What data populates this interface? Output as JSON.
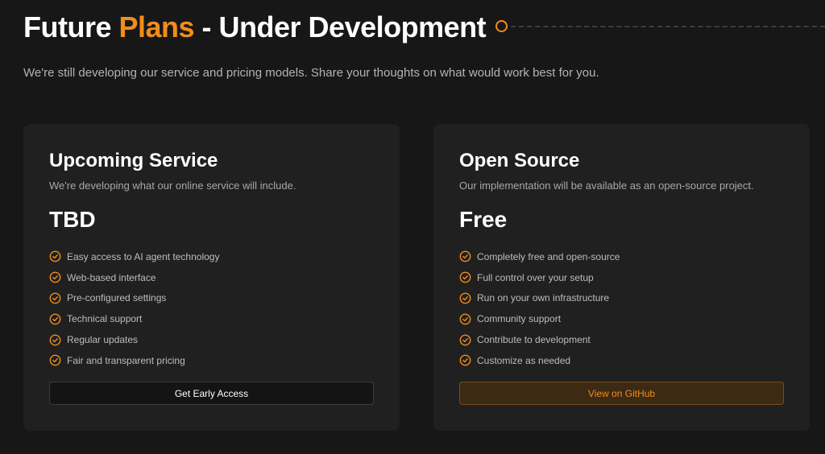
{
  "header": {
    "title_part1": "Future ",
    "title_accent": "Plans",
    "title_part2": " - Under Development",
    "subtitle": "We're still developing our service and pricing models. Share your thoughts on what would work best for you."
  },
  "colors": {
    "accent": "#f28c1a",
    "background": "#171717",
    "card": "#202020"
  },
  "icons": {
    "feature": "check-circle-icon"
  },
  "cards": [
    {
      "title": "Upcoming Service",
      "description": "We're developing what our online service will include.",
      "price": "TBD",
      "features": [
        "Easy access to AI agent technology",
        "Web-based interface",
        "Pre-configured settings",
        "Technical support",
        "Regular updates",
        "Fair and transparent pricing"
      ],
      "button_label": "Get Early Access"
    },
    {
      "title": "Open Source",
      "description": "Our implementation will be available as an open-source project.",
      "price": "Free",
      "features": [
        "Completely free and open-source",
        "Full control over your setup",
        "Run on your own infrastructure",
        "Community support",
        "Contribute to development",
        "Customize as needed"
      ],
      "button_label": "View on GitHub"
    }
  ]
}
